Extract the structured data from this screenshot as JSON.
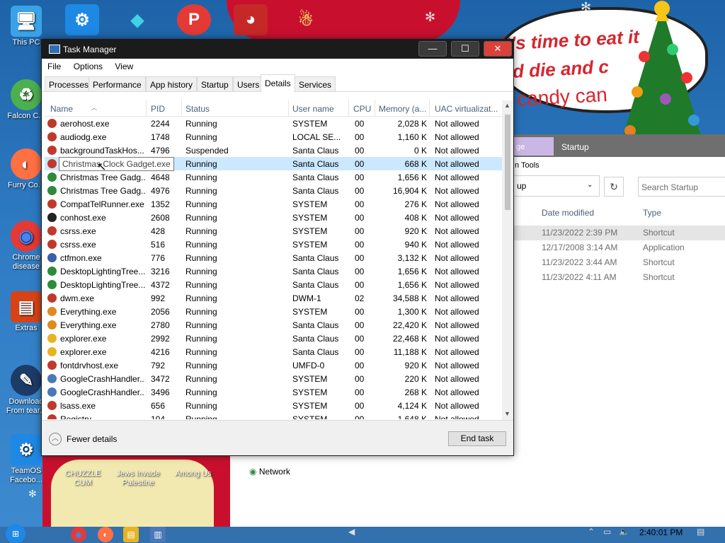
{
  "desktop": {
    "icons": [
      {
        "label": "This PC",
        "glyph": "🖥"
      },
      {
        "label": "Falcon C...",
        "glyph": "♻"
      },
      {
        "label": "Furry Co...",
        "glyph": "🦊"
      },
      {
        "label": "Chrome disease",
        "glyph": "◉"
      },
      {
        "label": "Extras",
        "glyph": "▤"
      },
      {
        "label": "Download From tear...",
        "glyph": "✎"
      },
      {
        "label": "TeamOS Facebo...",
        "glyph": "⚙"
      }
    ],
    "bottom_icons": [
      {
        "label": "CHUZZLE CUM"
      },
      {
        "label": "Jews Invade Palestine"
      },
      {
        "label": "Among Us"
      }
    ],
    "bubble": {
      "line1": "it's time to eat it",
      "line2": "nd die and c",
      "line3": "candy can"
    }
  },
  "explorer": {
    "tab_highlight": "ge",
    "tab_startup": "Startup",
    "tools": "n Tools",
    "address": "up",
    "search_placeholder": "Search Startup",
    "columns": {
      "date": "Date modified",
      "type": "Type"
    },
    "rows": [
      {
        "date": "11/23/2022 2:39 PM",
        "type": "Shortcut"
      },
      {
        "date": "12/17/2008 3:14 AM",
        "type": "Application"
      },
      {
        "date": "11/23/2022 3:44 AM",
        "type": "Shortcut"
      },
      {
        "date": "11/23/2022 4:11 AM",
        "type": "Shortcut"
      }
    ],
    "network": "Network"
  },
  "task_manager": {
    "title": "Task Manager",
    "menu": [
      "File",
      "Options",
      "View"
    ],
    "tabs": [
      "Processes",
      "Performance",
      "App history",
      "Startup",
      "Users",
      "Details",
      "Services"
    ],
    "active_tab": "Details",
    "columns": {
      "name": "Name",
      "pid": "PID",
      "status": "Status",
      "user": "User name",
      "cpu": "CPU",
      "memory": "Memory (a...",
      "uac": "UAC virtualizat..."
    },
    "tooltip": "Christmas Clock Gadget.exe",
    "rows": [
      {
        "name": "aerohost.exe",
        "pid": "2244",
        "status": "Running",
        "user": "SYSTEM",
        "cpu": "00",
        "memory": "2,028 K",
        "uac": "Not allowed",
        "icon": "#c0392b"
      },
      {
        "name": "audiodg.exe",
        "pid": "1748",
        "status": "Running",
        "user": "LOCAL SE...",
        "cpu": "00",
        "memory": "1,160 K",
        "uac": "Not allowed",
        "icon": "#c0392b"
      },
      {
        "name": "backgroundTaskHos...",
        "pid": "4796",
        "status": "Suspended",
        "user": "Santa Claus",
        "cpu": "00",
        "memory": "0 K",
        "uac": "Not allowed",
        "icon": "#c0392b"
      },
      {
        "name": "Christmas Clock Gadget.exe",
        "pid": "",
        "status": "Running",
        "user": "Santa Claus",
        "cpu": "00",
        "memory": "668 K",
        "uac": "Not allowed",
        "icon": "#c0392b"
      },
      {
        "name": "Christmas Tree Gadg...",
        "pid": "4648",
        "status": "Running",
        "user": "Santa Claus",
        "cpu": "00",
        "memory": "1,656 K",
        "uac": "Not allowed",
        "icon": "#2e8b3a"
      },
      {
        "name": "Christmas Tree Gadg...",
        "pid": "4976",
        "status": "Running",
        "user": "Santa Claus",
        "cpu": "00",
        "memory": "16,904 K",
        "uac": "Not allowed",
        "icon": "#2e8b3a"
      },
      {
        "name": "CompatTelRunner.exe",
        "pid": "1352",
        "status": "Running",
        "user": "SYSTEM",
        "cpu": "00",
        "memory": "276 K",
        "uac": "Not allowed",
        "icon": "#c0392b"
      },
      {
        "name": "conhost.exe",
        "pid": "2608",
        "status": "Running",
        "user": "SYSTEM",
        "cpu": "00",
        "memory": "408 K",
        "uac": "Not allowed",
        "icon": "#222222"
      },
      {
        "name": "csrss.exe",
        "pid": "428",
        "status": "Running",
        "user": "SYSTEM",
        "cpu": "00",
        "memory": "920 K",
        "uac": "Not allowed",
        "icon": "#c0392b"
      },
      {
        "name": "csrss.exe",
        "pid": "516",
        "status": "Running",
        "user": "SYSTEM",
        "cpu": "00",
        "memory": "940 K",
        "uac": "Not allowed",
        "icon": "#c0392b"
      },
      {
        "name": "ctfmon.exe",
        "pid": "776",
        "status": "Running",
        "user": "Santa Claus",
        "cpu": "00",
        "memory": "3,132 K",
        "uac": "Not allowed",
        "icon": "#3a5fa8"
      },
      {
        "name": "DesktopLightingTree...",
        "pid": "3216",
        "status": "Running",
        "user": "Santa Claus",
        "cpu": "00",
        "memory": "1,656 K",
        "uac": "Not allowed",
        "icon": "#2e8b3a"
      },
      {
        "name": "DesktopLightingTree...",
        "pid": "4372",
        "status": "Running",
        "user": "Santa Claus",
        "cpu": "00",
        "memory": "1,656 K",
        "uac": "Not allowed",
        "icon": "#2e8b3a"
      },
      {
        "name": "dwm.exe",
        "pid": "992",
        "status": "Running",
        "user": "DWM-1",
        "cpu": "02",
        "memory": "34,588 K",
        "uac": "Not allowed",
        "icon": "#c0392b"
      },
      {
        "name": "Everything.exe",
        "pid": "2056",
        "status": "Running",
        "user": "SYSTEM",
        "cpu": "00",
        "memory": "1,300 K",
        "uac": "Not allowed",
        "icon": "#e08a1e"
      },
      {
        "name": "Everything.exe",
        "pid": "2780",
        "status": "Running",
        "user": "Santa Claus",
        "cpu": "00",
        "memory": "22,420 K",
        "uac": "Not allowed",
        "icon": "#e08a1e"
      },
      {
        "name": "explorer.exe",
        "pid": "2992",
        "status": "Running",
        "user": "Santa Claus",
        "cpu": "00",
        "memory": "22,468 K",
        "uac": "Not allowed",
        "icon": "#e6b422"
      },
      {
        "name": "explorer.exe",
        "pid": "4216",
        "status": "Running",
        "user": "Santa Claus",
        "cpu": "00",
        "memory": "11,188 K",
        "uac": "Not allowed",
        "icon": "#e6b422"
      },
      {
        "name": "fontdrvhost.exe",
        "pid": "792",
        "status": "Running",
        "user": "UMFD-0",
        "cpu": "00",
        "memory": "920 K",
        "uac": "Not allowed",
        "icon": "#c0392b"
      },
      {
        "name": "GoogleCrashHandler...",
        "pid": "3472",
        "status": "Running",
        "user": "SYSTEM",
        "cpu": "00",
        "memory": "220 K",
        "uac": "Not allowed",
        "icon": "#4a78b8"
      },
      {
        "name": "GoogleCrashHandler...",
        "pid": "3496",
        "status": "Running",
        "user": "SYSTEM",
        "cpu": "00",
        "memory": "268 K",
        "uac": "Not allowed",
        "icon": "#4a78b8"
      },
      {
        "name": "lsass.exe",
        "pid": "656",
        "status": "Running",
        "user": "SYSTEM",
        "cpu": "00",
        "memory": "4,124 K",
        "uac": "Not allowed",
        "icon": "#c0392b"
      },
      {
        "name": "Registry",
        "pid": "104",
        "status": "Running",
        "user": "SYSTEM",
        "cpu": "00",
        "memory": "1,648 K",
        "uac": "Not allowed",
        "icon": "#c0392b"
      }
    ],
    "footer": {
      "fewer_details": "Fewer details",
      "end_task": "End task"
    }
  },
  "taskbar": {
    "clock": "2:40:01 PM"
  }
}
